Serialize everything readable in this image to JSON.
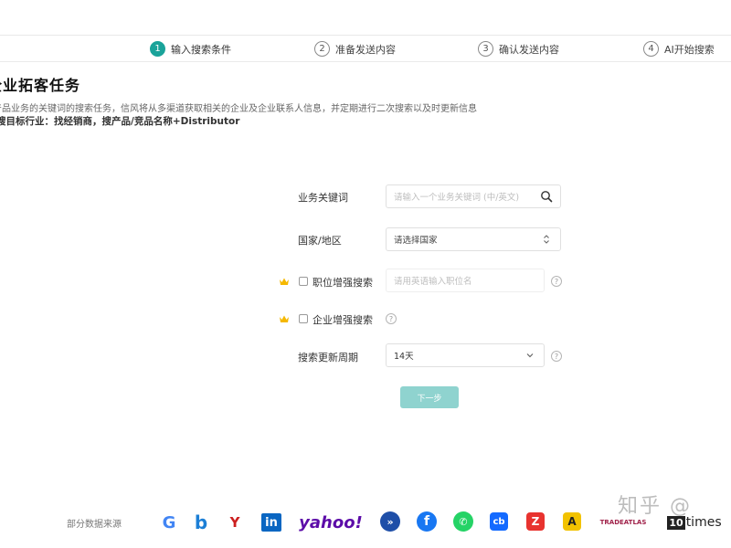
{
  "stepper": {
    "steps": [
      {
        "num": "1",
        "label": "输入搜索条件",
        "active": true
      },
      {
        "num": "2",
        "label": "准备发送内容",
        "active": false
      },
      {
        "num": "3",
        "label": "确认发送内容",
        "active": false
      },
      {
        "num": "4",
        "label": "AI开始搜索",
        "active": false
      }
    ]
  },
  "header": {
    "title": "企业拓客任务",
    "description": "产品业务的关键词的搜索任务，信风将从多渠道获取相关的企业及企业联系人信息，并定期进行二次搜索以及时更新信息",
    "tip": "搜目标行业：找经销商，搜产品/竞品名称+Distributor"
  },
  "form": {
    "keyword": {
      "label": "业务关键词",
      "placeholder": "请输入一个业务关键词 (中/英文)"
    },
    "country": {
      "label": "国家/地区",
      "value": "请选择国家"
    },
    "position": {
      "label": "职位增强搜索",
      "placeholder": "请用英语输入职位名"
    },
    "company": {
      "label": "企业增强搜索"
    },
    "period": {
      "label": "搜索更新周期",
      "value": "14天"
    },
    "help_glyph": "?",
    "next_label": "下一步"
  },
  "footer": {
    "sources_label": "部分数据来源",
    "logos": {
      "google": "G",
      "bing": "b",
      "yandex": "Y",
      "linkedin": "in",
      "yahoo": "yahoo!",
      "zoominfo": "»",
      "facebook": "f",
      "whatsapp": "✆",
      "crunchbase": "cb",
      "zenrows": "Z",
      "apollo": "A",
      "tradeatlas": "TRADEATLAS",
      "tentimes_num": "10",
      "tentimes_word": "times"
    },
    "logo_colors": {
      "zoominfo": "#1f4fa8",
      "facebook": "#1877f2",
      "whatsapp": "#25d366",
      "crunchbase": "#146aff",
      "zenrows": "#e8332f",
      "apollo": "#f2c200"
    },
    "watermark": "知乎 @"
  },
  "colors": {
    "accent": "#1aa39a",
    "button_disabled": "#8fd3cf",
    "crown": "#f5b800"
  }
}
